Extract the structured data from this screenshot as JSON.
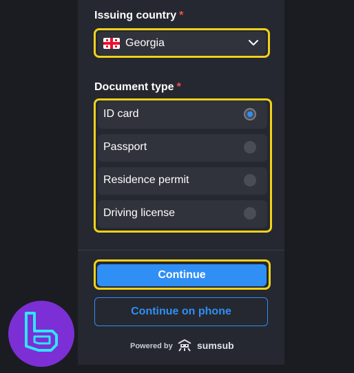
{
  "form": {
    "country_label": "Issuing country",
    "doc_label": "Document type",
    "required_marker": "*",
    "country_value": "Georgia",
    "country_flag_icon": "georgia-flag-icon",
    "document_options": [
      {
        "label": "ID card",
        "selected": true
      },
      {
        "label": "Passport",
        "selected": false
      },
      {
        "label": "Residence permit",
        "selected": false
      },
      {
        "label": "Driving license",
        "selected": false
      }
    ],
    "continue_label": "Continue",
    "continue_phone_label": "Continue on phone"
  },
  "footer": {
    "powered_by": "Powered by",
    "brand": "sumsub"
  },
  "colors": {
    "accent": "#2f8ff5",
    "highlight": "#f1d21a",
    "required": "#ff4d4f",
    "logo_bg": "#7c2fd4",
    "logo_fg": "#2ee6ff"
  }
}
